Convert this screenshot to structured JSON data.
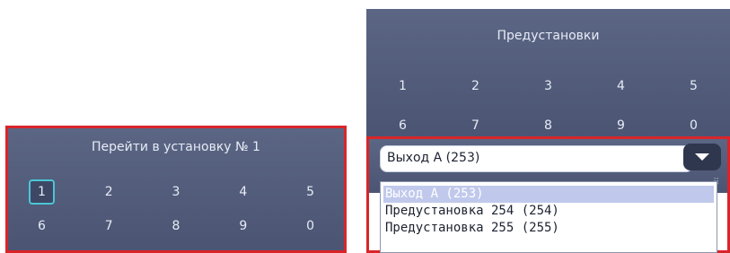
{
  "goto_panel": {
    "title": "Перейти в установку № 1",
    "keys_row1": [
      "1",
      "2",
      "3",
      "4",
      "5"
    ],
    "keys_row2": [
      "6",
      "7",
      "8",
      "9",
      "0"
    ],
    "selected_key": "1"
  },
  "presets_panel": {
    "title": "Предустановки",
    "keys_row1": [
      "1",
      "2",
      "3",
      "4",
      "5"
    ],
    "keys_row2": [
      "6",
      "7",
      "8",
      "9",
      "0"
    ]
  },
  "output_select": {
    "value": "Выход А (253)",
    "options": [
      "Выход А (253)",
      "Предустановка 254 (254)",
      "Предустановка 255 (255)"
    ],
    "active_option_index": 0
  },
  "colors": {
    "panel": "#5b6684",
    "highlight_border": "#d9252a",
    "selected_key_border": "#4cc5d6"
  },
  "icons": {
    "dropdown_arrow": "chevron-down-icon",
    "resize_grip": "resize-grip-icon"
  }
}
